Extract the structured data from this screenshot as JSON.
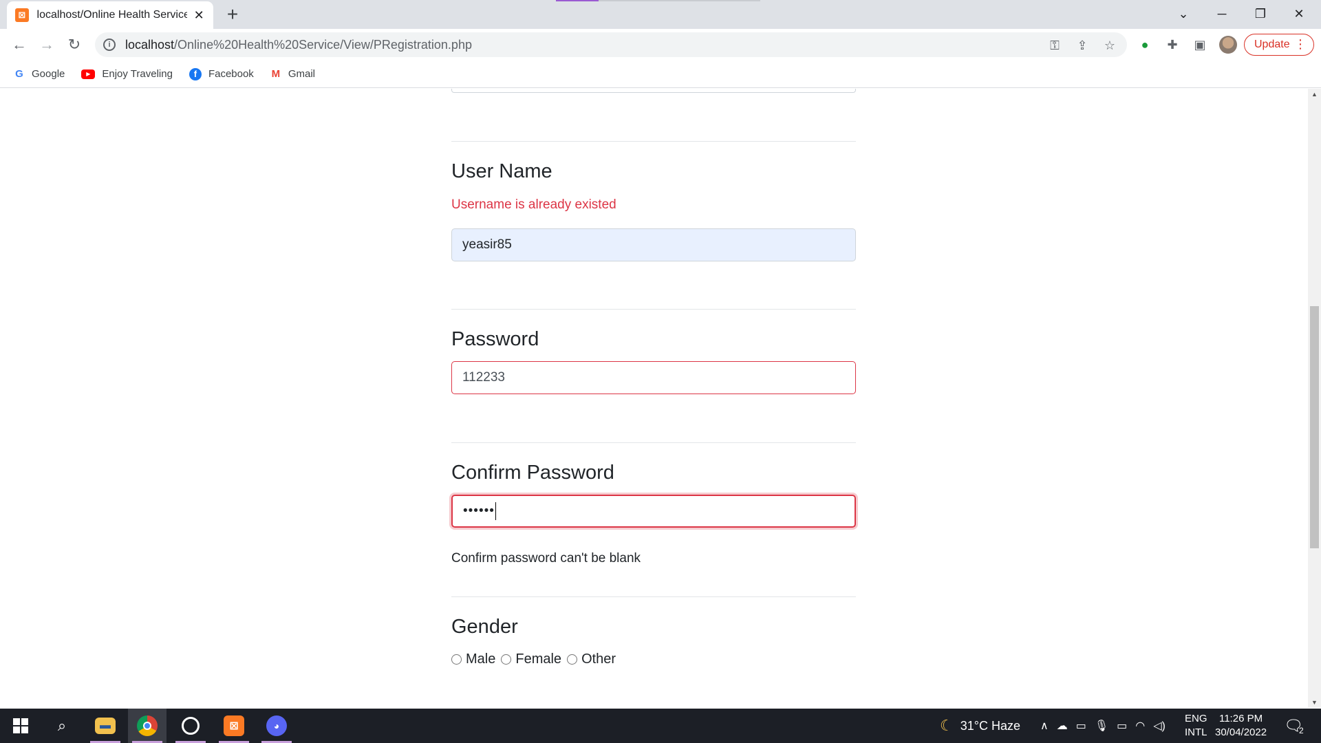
{
  "browser": {
    "tab_title": "localhost/Online Health Service/View/PRegistration.php",
    "url_host": "localhost",
    "url_path": "/Online%20Health%20Service/View/PRegistration.php",
    "update_label": "Update",
    "bookmarks": [
      {
        "label": "Google",
        "icon": "google-icon"
      },
      {
        "label": "Enjoy Traveling",
        "icon": "youtube-icon"
      },
      {
        "label": "Facebook",
        "icon": "facebook-icon"
      },
      {
        "label": "Gmail",
        "icon": "gmail-icon"
      }
    ]
  },
  "form": {
    "username": {
      "label": "User Name",
      "error": "Username is already existed",
      "value": "yeasir85"
    },
    "password": {
      "label": "Password",
      "value": "112233"
    },
    "confirm_password": {
      "label": "Confirm Password",
      "value": "••••••",
      "message": "Confirm password can't be blank"
    },
    "gender": {
      "label": "Gender",
      "options": [
        "Male",
        "Female",
        "Other"
      ]
    }
  },
  "taskbar": {
    "weather": "31°C  Haze",
    "lang_top": "ENG",
    "lang_bottom": "INTL",
    "time": "11:26 PM",
    "date": "30/04/2022",
    "notification_count": "2"
  },
  "colors": {
    "error": "#dc3545",
    "autofill": "#e8f0fe",
    "taskbar": "#1c1f26"
  }
}
